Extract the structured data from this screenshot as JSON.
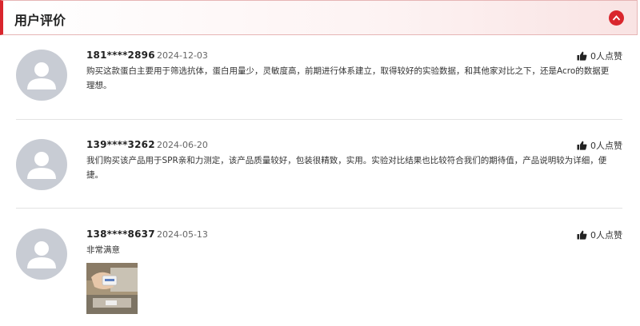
{
  "header": {
    "title": "用户评价"
  },
  "reviews": [
    {
      "user": "181****2896",
      "date": "2024-12-03",
      "likes": "0人点赞",
      "content": "购买这款蛋白主要用于筛选抗体，蛋白用量少，灵敏度高，前期进行体系建立，取得较好的实验数据，和其他家对比之下，还是Acro的数据更理想。"
    },
    {
      "user": "139****3262",
      "date": "2024-06-20",
      "likes": "0人点赞",
      "content": "我们购买该产品用于SPR亲和力测定，该产品质量较好，包装很精致，实用。实验对比结果也比较符合我们的期待值，产品说明较为详细，便捷。"
    },
    {
      "user": "138****8637",
      "date": "2024-05-13",
      "likes": "0人点赞",
      "content": "非常满意"
    }
  ],
  "colors": {
    "accent": "#d9262d",
    "avatar": "#c8ccd4"
  }
}
